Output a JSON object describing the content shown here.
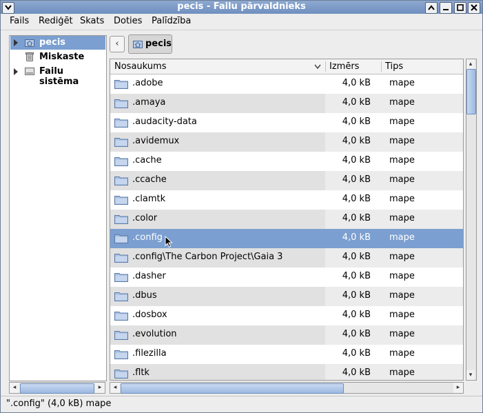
{
  "window": {
    "title": "pecis - Failu pārvaldnieks"
  },
  "menu": [
    "Fails",
    "Rediģēt",
    "Skats",
    "Doties",
    "Palīdzība"
  ],
  "sidebar": {
    "items": [
      {
        "label": "pecis",
        "icon": "home-folder-icon",
        "expandable": true,
        "selected": true
      },
      {
        "label": "Miskaste",
        "icon": "trash-icon",
        "expandable": false,
        "selected": false
      },
      {
        "label": "Failu sistēma",
        "icon": "drive-icon",
        "expandable": true,
        "selected": false
      }
    ]
  },
  "location": {
    "back_label": "‹",
    "path_label": "pecis"
  },
  "columns": {
    "name": "Nosaukums",
    "size": "Izmērs",
    "type": "Tips"
  },
  "files": [
    {
      "name": ".adobe",
      "size": "4,0 kB",
      "type": "mape"
    },
    {
      "name": ".amaya",
      "size": "4,0 kB",
      "type": "mape"
    },
    {
      "name": ".audacity-data",
      "size": "4,0 kB",
      "type": "mape"
    },
    {
      "name": ".avidemux",
      "size": "4,0 kB",
      "type": "mape"
    },
    {
      "name": ".cache",
      "size": "4,0 kB",
      "type": "mape"
    },
    {
      "name": ".ccache",
      "size": "4,0 kB",
      "type": "mape"
    },
    {
      "name": ".clamtk",
      "size": "4,0 kB",
      "type": "mape"
    },
    {
      "name": ".color",
      "size": "4,0 kB",
      "type": "mape"
    },
    {
      "name": ".config",
      "size": "4,0 kB",
      "type": "mape"
    },
    {
      "name": ".config\\The Carbon Project\\Gaia 3",
      "size": "4,0 kB",
      "type": "mape"
    },
    {
      "name": ".dasher",
      "size": "4,0 kB",
      "type": "mape"
    },
    {
      "name": ".dbus",
      "size": "4,0 kB",
      "type": "mape"
    },
    {
      "name": ".dosbox",
      "size": "4,0 kB",
      "type": "mape"
    },
    {
      "name": ".evolution",
      "size": "4,0 kB",
      "type": "mape"
    },
    {
      "name": ".filezilla",
      "size": "4,0 kB",
      "type": "mape"
    },
    {
      "name": ".fltk",
      "size": "4,0 kB",
      "type": "mape"
    }
  ],
  "selected_index": 8,
  "status": {
    "text": "\".config\" (4,0 kB) mape"
  },
  "colors": {
    "selection": "#7b9fd0",
    "titlebar": "#7b9ac8"
  }
}
